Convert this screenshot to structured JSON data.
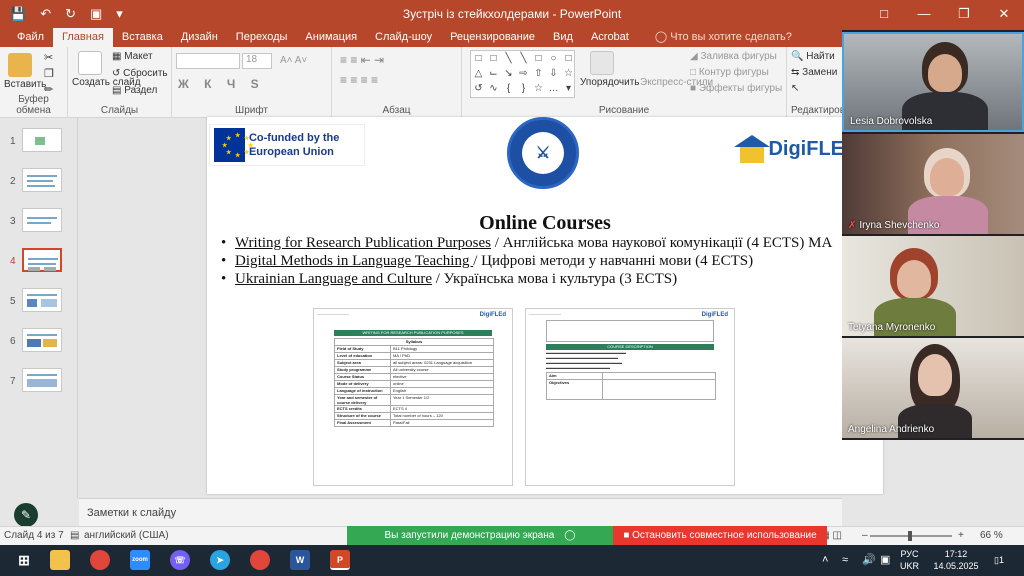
{
  "app": {
    "window_title": "Зустріч із стейкхолдерами - PowerPoint",
    "quick_access": [
      "save-icon",
      "undo-icon",
      "redo-icon",
      "present-icon"
    ],
    "window_controls": [
      "ribbon-display-icon",
      "minimize-icon",
      "maximize-icon",
      "close-icon"
    ]
  },
  "tabs": [
    {
      "label": "Файл"
    },
    {
      "label": "Главная"
    },
    {
      "label": "Вставка"
    },
    {
      "label": "Дизайн"
    },
    {
      "label": "Переходы"
    },
    {
      "label": "Анимация"
    },
    {
      "label": "Слайд-шоу"
    },
    {
      "label": "Рецензирование"
    },
    {
      "label": "Вид"
    },
    {
      "label": "Acrobat"
    }
  ],
  "tell_me": "Что вы хотите сделать?",
  "ribbon": {
    "paste": "Вставить",
    "clipboard": "Буфер обмена",
    "create_slide": "Создать слайд",
    "layout": "Макет",
    "reset": "Сбросить",
    "section": "Раздел",
    "slides": "Слайды",
    "font_size": "18",
    "font_group": "Шрифт",
    "format_letters": "Ж К Ч S",
    "paragraph": "Абзац",
    "arrange": "Упорядочить",
    "express": "Экспресс-стили",
    "fill": "Заливка фигуры",
    "outline": "Контур фигуры",
    "effects": "Эффекты фигуры",
    "drawing": "Рисование",
    "find": "Найти",
    "replace": "Замени",
    "edit": "Редактирова"
  },
  "thumbnails": [
    {
      "num": "1"
    },
    {
      "num": "2"
    },
    {
      "num": "3"
    },
    {
      "num": "4"
    },
    {
      "num": "5"
    },
    {
      "num": "6"
    },
    {
      "num": "7"
    }
  ],
  "slide": {
    "eu_text": "Co-funded by the European Union",
    "digi_text": "DigiFLE",
    "title": "Online Courses",
    "courses": [
      {
        "en": "Writing for Research Publication Purposes",
        "ua": " / Англійська мова наукової комунікації  (4 ECTS) MA"
      },
      {
        "en": "Digital Methods in Language Teaching ",
        "ua": "/  Цифрові методи у навчанні мови (4 ECTS)"
      },
      {
        "en": "Ukrainian Language and Culture",
        "ua": " / Українська мова і культура  (3 ECTS)"
      }
    ],
    "doc_left": {
      "logo": "DigiFLEd",
      "bar": "WRITING FOR RESEARCH PUBLICATION PURPOSES",
      "syllabus": "Syllabus",
      "rows": [
        [
          "Field of Study",
          "B11 Philology"
        ],
        [
          "Level of education",
          "MA / PhD"
        ],
        [
          "Subject area",
          "all subject areas: 0231 Language acquisition"
        ],
        [
          "Study programme",
          "All university course"
        ],
        [
          "Course Status",
          "elective"
        ],
        [
          "Mode of delivery",
          "online"
        ],
        [
          "Language of instruction",
          "English"
        ],
        [
          "Year and semester of course delivery",
          "Year 1 Semester 1/2"
        ],
        [
          "ECTS credits",
          "ECTS 4"
        ],
        [
          "Structure of the course",
          "Total number of hours – 120"
        ],
        [
          "Final Assessment",
          "Pass/Fail"
        ]
      ]
    },
    "doc_right": {
      "logo": "DigiFLEd",
      "bar": "COURSE DESCRIPTION",
      "aim": "Aim",
      "objectives": "Objectives"
    }
  },
  "notes": "Заметки к слайду",
  "status": {
    "slide_count": "Слайд 4 из 7",
    "language": "английский (США)",
    "sharing": "Вы запустили демонстрацию экрана",
    "stop_sharing": "Остановить совместное использование",
    "zoom": "66 %"
  },
  "participants": [
    {
      "name": "Lesia Dobrovolska",
      "muted": false
    },
    {
      "name": "Iryna Shevchenko",
      "muted": true
    },
    {
      "name": "Tetyana Myronenko",
      "muted": false
    },
    {
      "name": "Angelina Andrienko",
      "muted": false
    }
  ],
  "taskbar": {
    "lang_top": "РУС",
    "lang_bottom": "UKR",
    "time": "17:12",
    "date": "14.05.2025",
    "notifications": "1"
  },
  "colors": {
    "accent": "#b7472a",
    "share_green": "#34a853",
    "stop_red": "#e8372c"
  }
}
